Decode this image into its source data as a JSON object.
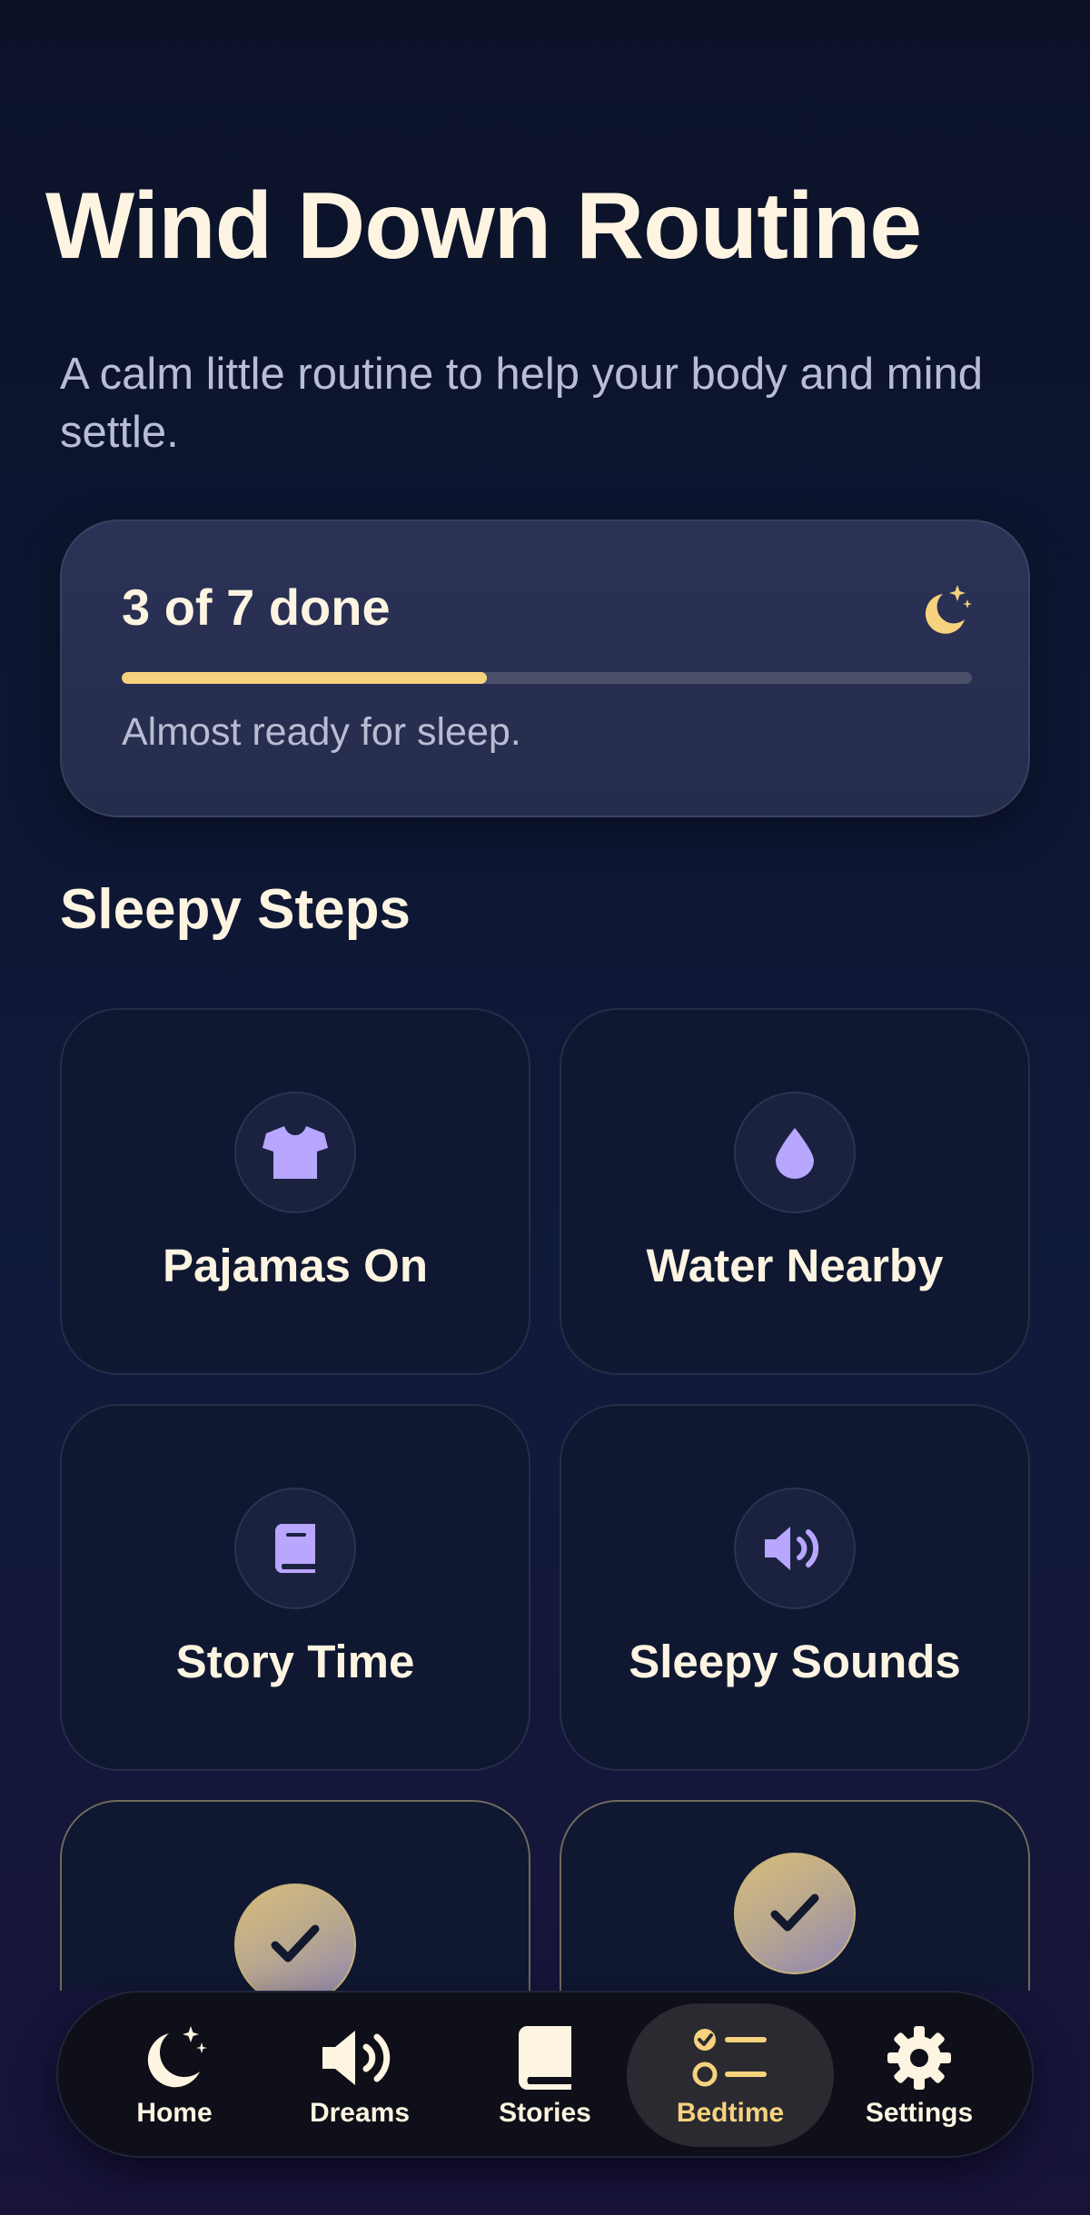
{
  "header": {
    "title": "Wind Down Routine",
    "subtitle": "A calm little routine to help your body and mind settle."
  },
  "progress": {
    "count_label": "3 of 7 done",
    "completed": 3,
    "total": 7,
    "fraction": 0.43,
    "note": "Almost ready for sleep.",
    "icon": "moon-stars-icon"
  },
  "steps_section": {
    "title": "Sleepy Steps",
    "items": [
      {
        "label": "Pajamas On",
        "icon": "shirt-icon",
        "done": false
      },
      {
        "label": "Water Nearby",
        "icon": "droplet-icon",
        "done": false
      },
      {
        "label": "Story Time",
        "icon": "book-icon",
        "done": false
      },
      {
        "label": "Sleepy Sounds",
        "icon": "speaker-icon",
        "done": false
      },
      {
        "label": "",
        "icon": "check-icon",
        "done": true
      },
      {
        "label": "",
        "icon": "check-icon",
        "done": true
      }
    ]
  },
  "tabbar": {
    "active": "Bedtime",
    "tabs": [
      {
        "label": "Home",
        "icon": "moon-stars-icon"
      },
      {
        "label": "Dreams",
        "icon": "speaker-icon"
      },
      {
        "label": "Stories",
        "icon": "book-icon"
      },
      {
        "label": "Bedtime",
        "icon": "checklist-icon"
      },
      {
        "label": "Settings",
        "icon": "gear-icon"
      }
    ]
  },
  "colors": {
    "accent": "#f7d27e",
    "icon_lavender": "#b8a6ff",
    "text_primary": "#fdf4e1",
    "text_secondary": "#b9bdd4"
  }
}
